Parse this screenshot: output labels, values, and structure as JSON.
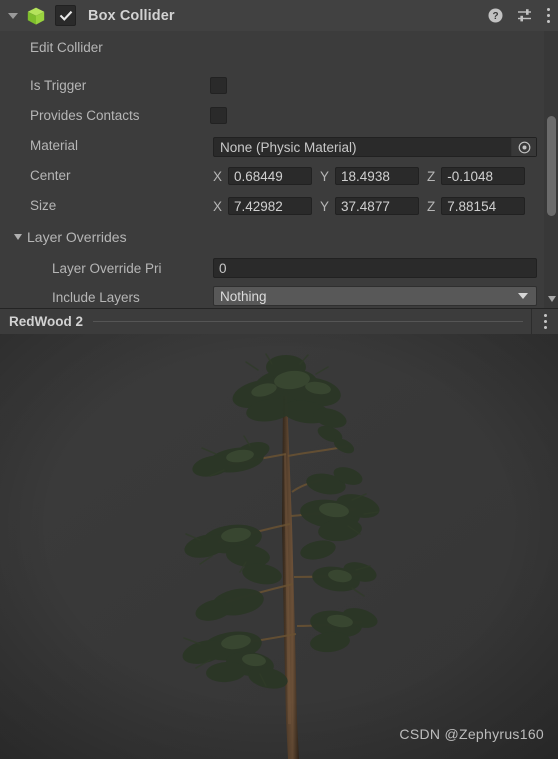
{
  "component": {
    "title": "Box Collider",
    "enabled": true,
    "icon": "box-collider-cube-icon",
    "accent_green": "#8fd13e",
    "header_icons": [
      {
        "name": "help-icon",
        "glyph": "?"
      },
      {
        "name": "preset-icon",
        "glyph": "sliders"
      },
      {
        "name": "more-menu-icon",
        "glyph": "kebab"
      }
    ]
  },
  "properties": {
    "edit_collider_label": "Edit Collider",
    "is_trigger_label": "Is Trigger",
    "is_trigger_value": false,
    "provides_contacts_label": "Provides Contacts",
    "provides_contacts_value": false,
    "material_label": "Material",
    "material_value": "None (Physic Material)",
    "center_label": "Center",
    "center": {
      "x_axis": "X",
      "x": "0.68449",
      "y_axis": "Y",
      "y": "18.4938",
      "z_axis": "Z",
      "z": "-0.1048"
    },
    "size_label": "Size",
    "size": {
      "x_axis": "X",
      "x": "7.42982",
      "y_axis": "Y",
      "y": "37.4877",
      "z_axis": "Z",
      "z": "7.88154"
    }
  },
  "layer_overrides": {
    "section_label": "Layer Overrides",
    "expanded": true,
    "priority_label": "Layer Override Pri",
    "priority_value": "0",
    "include_layers_label": "Include Layers",
    "include_layers_value": "Nothing"
  },
  "preview": {
    "title": "RedWood 2",
    "menu_icon": "kebab-menu-icon",
    "watermark": "CSDN @Zephyrus160",
    "background": "#393939"
  },
  "colors": {
    "panel_bg": "#3c3c3c",
    "header_bg": "#414141",
    "field_bg": "#2a2a2a",
    "dropdown_bg": "#585858",
    "label_text": "#b6b6b6",
    "value_text": "#d0d0d0"
  }
}
